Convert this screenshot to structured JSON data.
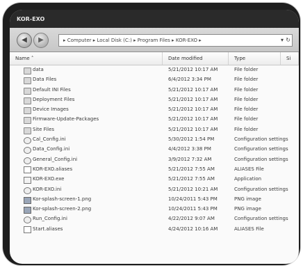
{
  "window": {
    "title": "KOR-EXO"
  },
  "nav": {
    "back_icon": "back-arrow",
    "forward_icon": "forward-arrow"
  },
  "address": {
    "path": "▸ Computer ▸ Local Disk (C:) ▸ Program Files ▸ KOR-EXO ▸"
  },
  "columns": {
    "name": "Name",
    "date": "Date modified",
    "type": "Type",
    "size": "Si"
  },
  "files": [
    {
      "name": "data",
      "date": "5/21/2012 10:17 AM",
      "type": "File folder",
      "icon": "folder-icon"
    },
    {
      "name": "Data Files",
      "date": "6/4/2012 3:34 PM",
      "type": "File folder",
      "icon": "folder-icon"
    },
    {
      "name": "Default INI Files",
      "date": "5/21/2012 10:17 AM",
      "type": "File folder",
      "icon": "folder-icon"
    },
    {
      "name": "Deployment Files",
      "date": "5/21/2012 10:17 AM",
      "type": "File folder",
      "icon": "folder-icon"
    },
    {
      "name": "Device Images",
      "date": "5/21/2012 10:17 AM",
      "type": "File folder",
      "icon": "folder-icon"
    },
    {
      "name": "Firmware-Update-Packages",
      "date": "5/21/2012 10:17 AM",
      "type": "File folder",
      "icon": "folder-icon"
    },
    {
      "name": "Site Files",
      "date": "5/21/2012 10:17 AM",
      "type": "File folder",
      "icon": "folder-icon"
    },
    {
      "name": "Cal_Config.ini",
      "date": "5/30/2012 1:54 PM",
      "type": "Configuration settings",
      "icon": "config-file-icon"
    },
    {
      "name": "Data_Config.ini",
      "date": "4/4/2012 3:38 PM",
      "type": "Configuration settings",
      "icon": "config-file-icon"
    },
    {
      "name": "General_Config.ini",
      "date": "3/9/2012 7:32 AM",
      "type": "Configuration settings",
      "icon": "config-file-icon"
    },
    {
      "name": "KOR-EXO.aliases",
      "date": "5/21/2012 7:55 AM",
      "type": "ALIASES File",
      "icon": "file-icon"
    },
    {
      "name": "KOR-EXO.exe",
      "date": "5/21/2012 7:55 AM",
      "type": "Application",
      "icon": "application-icon"
    },
    {
      "name": "KOR-EXO.ini",
      "date": "5/21/2012 10:21 AM",
      "type": "Configuration settings",
      "icon": "config-file-icon"
    },
    {
      "name": "Kor-splash-screen-1.png",
      "date": "10/24/2011 5:43 PM",
      "type": "PNG image",
      "icon": "image-file-icon"
    },
    {
      "name": "Kor-splash-screen-2.png",
      "date": "10/24/2011 5:43 PM",
      "type": "PNG image",
      "icon": "image-file-icon"
    },
    {
      "name": "Run_Config.ini",
      "date": "4/22/2012 9:07 AM",
      "type": "Configuration settings",
      "icon": "config-file-icon"
    },
    {
      "name": "Start.aliases",
      "date": "4/24/2012 10:16 AM",
      "type": "ALIASES File",
      "icon": "file-icon"
    }
  ]
}
